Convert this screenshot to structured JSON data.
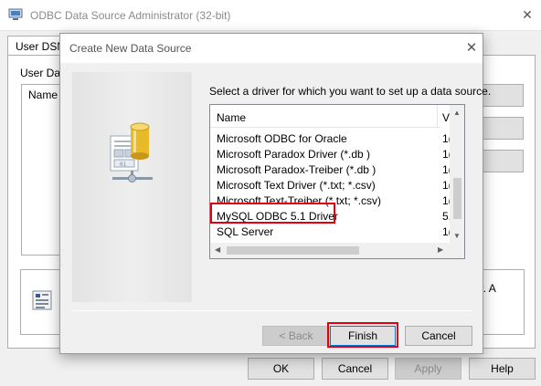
{
  "background_window": {
    "title": "ODBC Data Source Administrator (32-bit)",
    "close_glyph": "✕",
    "tab_label": "User DSN",
    "section_label": "User Data",
    "list_header": "Name",
    "info_text": "der.  A",
    "buttons": {
      "ok": "OK",
      "cancel": "Cancel",
      "apply": "Apply",
      "help": "Help"
    }
  },
  "dialog": {
    "title": "Create New Data Source",
    "close_glyph": "✕",
    "prompt": "Select a driver for which you want to set up a data source.",
    "columns": {
      "name": "Name",
      "version": "V"
    },
    "drivers": [
      {
        "name": "Microsoft ODBC for Oracle",
        "version": "1("
      },
      {
        "name": "Microsoft Paradox Driver (*.db )",
        "version": "1("
      },
      {
        "name": "Microsoft Paradox-Treiber (*.db )",
        "version": "1("
      },
      {
        "name": "Microsoft Text Driver (*.txt; *.csv)",
        "version": "1("
      },
      {
        "name": "Microsoft Text-Treiber (*.txt; *.csv)",
        "version": "1("
      },
      {
        "name": "MySQL ODBC 5.1 Driver",
        "version": "5."
      },
      {
        "name": "SQL Server",
        "version": "1("
      }
    ],
    "highlighted_driver": "MySQL ODBC 5.1 Driver",
    "buttons": {
      "back": "< Back",
      "finish": "Finish",
      "cancel": "Cancel"
    }
  },
  "colors": {
    "highlight": "#e3000f",
    "window_bg": "#f0f0f0",
    "button_bg": "#e1e1e1"
  }
}
